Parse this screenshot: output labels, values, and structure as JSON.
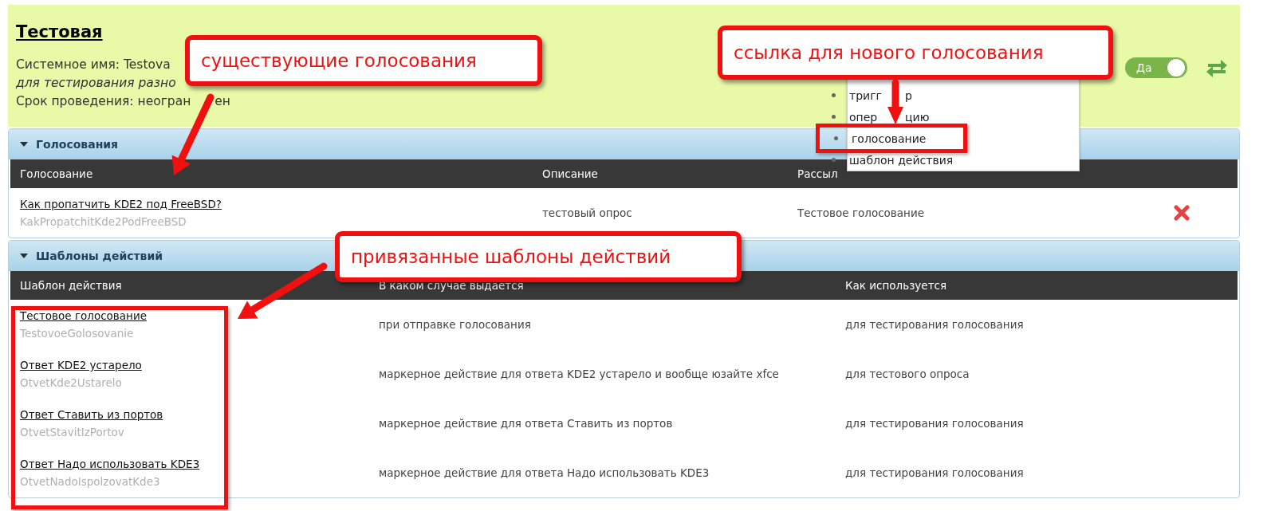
{
  "header": {
    "title": "Тестовая",
    "system_name": "Системное имя: Testova",
    "description": "для тестирования разно",
    "term": "Срок проведения: неогран",
    "term_tail": "ен",
    "toggle": {
      "label": "Да",
      "on": true
    }
  },
  "add_menu": {
    "items": [
      {
        "label": "тригг",
        "tail": "р",
        "highlighted": false
      },
      {
        "label": "опер",
        "tail": "цию",
        "highlighted": false
      },
      {
        "label": "голосование",
        "highlighted": true
      },
      {
        "label": "шаблон действия",
        "highlighted": false
      }
    ]
  },
  "sections": [
    {
      "title": "Голосования",
      "expanded": true,
      "highlighted_column": false,
      "columns": [
        "Голосование",
        "Описание",
        "Рассыл"
      ],
      "rows": [
        {
          "cells": [
            {
              "link": "Как пропатчить KDE2 под FreeBSD?",
              "code": "KakPropatchitKde2PodFreeBSD"
            },
            {
              "text": "тестовый опрос"
            },
            {
              "text": "Тестовое голосование"
            }
          ],
          "deletable": true
        }
      ]
    },
    {
      "title": "Шаблоны действий",
      "expanded": true,
      "highlighted_column": true,
      "columns": [
        "Шаблон действия",
        "В каком случае выдается",
        "Как используется"
      ],
      "rows": [
        {
          "cells": [
            {
              "link": "Тестовое голосование",
              "code": "TestovoeGolosovanie"
            },
            {
              "text": "при отправке голосования"
            },
            {
              "text": "для тестирования голосования"
            }
          ],
          "deletable": false
        },
        {
          "cells": [
            {
              "link": "Ответ KDE2 устарело",
              "code": "OtvetKde2Ustarelo"
            },
            {
              "text": "маркерное действие для ответа KDE2 устарело и вообще юзайте xfce"
            },
            {
              "text": "для тестового опроса"
            }
          ],
          "deletable": false
        },
        {
          "cells": [
            {
              "link": "Ответ Ставить из портов",
              "code": "OtvetStavitIzPortov"
            },
            {
              "text": "маркерное действие для ответа Ставить из портов"
            },
            {
              "text": "для тестирования голосования"
            }
          ],
          "deletable": false
        },
        {
          "cells": [
            {
              "link": "Ответ Надо использовать KDE3",
              "code": "OtvetNadoIspolzovatKde3"
            },
            {
              "text": "маркерное действие для ответа Надо использовать KDE3"
            },
            {
              "text": "для тестирования голосования"
            }
          ],
          "deletable": false
        }
      ]
    }
  ],
  "callouts": [
    {
      "text": "существующие голосования"
    },
    {
      "text": "ссылка для нового голосования"
    },
    {
      "text": "привязанные шаблоны действий"
    }
  ]
}
